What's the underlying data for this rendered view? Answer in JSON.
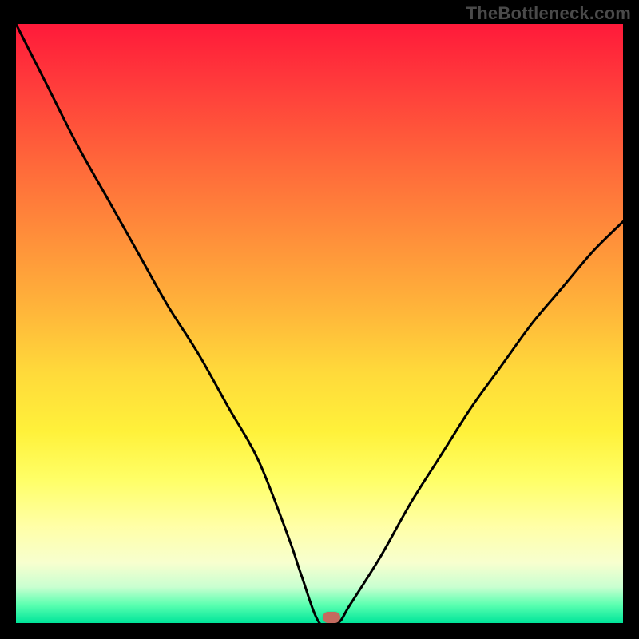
{
  "watermark": "TheBottleneck.com",
  "chart_data": {
    "type": "line",
    "title": "",
    "xlabel": "",
    "ylabel": "",
    "xlim": [
      0,
      100
    ],
    "ylim": [
      0,
      100
    ],
    "grid": false,
    "legend": false,
    "background_gradient": {
      "top": "#ff1a3a",
      "bottom": "#00e59a"
    },
    "series": [
      {
        "name": "bottleneck-curve",
        "x": [
          0,
          5,
          10,
          15,
          20,
          25,
          30,
          35,
          40,
          45,
          47,
          50,
          53,
          55,
          60,
          65,
          70,
          75,
          80,
          85,
          90,
          95,
          100
        ],
        "y": [
          100,
          90,
          80,
          71,
          62,
          53,
          45,
          36,
          27,
          14,
          8,
          0,
          0,
          3,
          11,
          20,
          28,
          36,
          43,
          50,
          56,
          62,
          67
        ]
      }
    ],
    "marker": {
      "x": 52,
      "y": 1,
      "color": "#c46a5f"
    }
  }
}
